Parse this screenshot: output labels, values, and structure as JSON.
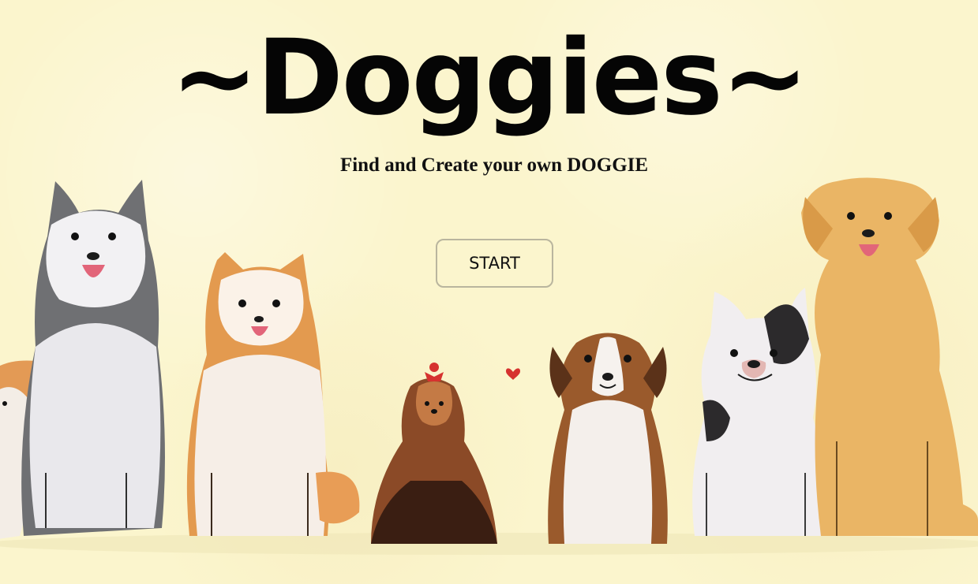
{
  "page": {
    "title": "~Doggies~",
    "subtitle": "Find and Create your own DOGGIE",
    "start_label": "START"
  },
  "illustration": {
    "dogs": [
      "corgi-dog",
      "husky-dog",
      "shiba-dog",
      "yorkie-dog",
      "beagle-dog",
      "french-bulldog",
      "golden-retriever-dog"
    ],
    "decorations": [
      "heart-icon"
    ]
  },
  "colors": {
    "background": "#fbf5cd",
    "text": "#050505",
    "button_border": "#b9b59e"
  }
}
